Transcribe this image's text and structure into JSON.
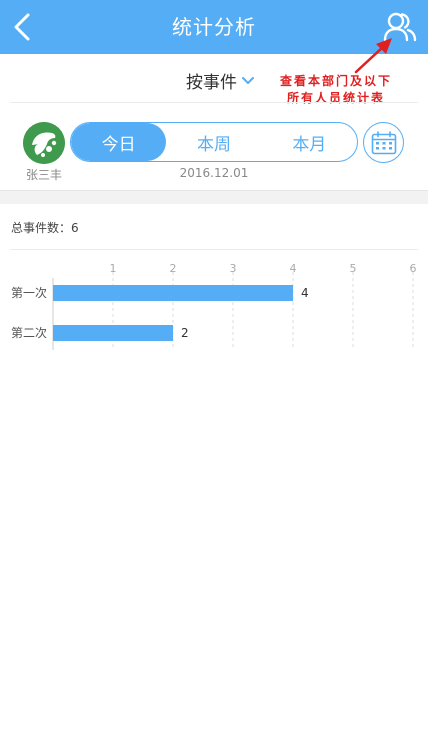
{
  "header": {
    "title": "统计分析",
    "back_icon": "chevron-left-icon",
    "people_icon": "people-icon"
  },
  "filter": {
    "label": "按事件",
    "icon": "chevron-down-icon"
  },
  "annotation": {
    "line1": "查看本部门及以下",
    "line2": "所有人员统计表"
  },
  "user": {
    "name": "张三丰"
  },
  "tabs": [
    {
      "label": "今日",
      "active": true
    },
    {
      "label": "本周",
      "active": false
    },
    {
      "label": "本月",
      "active": false
    }
  ],
  "date": "2016.12.01",
  "calendar_icon": "calendar-icon",
  "summary": {
    "total_label": "总事件数：6"
  },
  "colors": {
    "accent": "#55aef5",
    "annotation": "#e02020",
    "avatar": "#3f9a4d"
  },
  "chart_data": {
    "type": "bar",
    "orientation": "horizontal",
    "categories": [
      "第一次",
      "第二次"
    ],
    "values": [
      4,
      2
    ],
    "xticks": [
      1,
      2,
      3,
      4,
      5,
      6
    ],
    "xlim": [
      0,
      6
    ],
    "grid": true
  }
}
